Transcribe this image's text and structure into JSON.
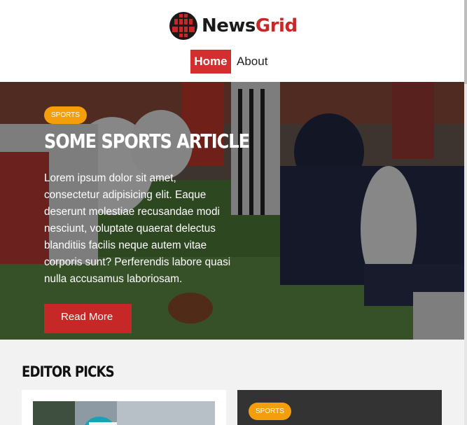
{
  "site": {
    "name_part1": "News",
    "name_part2": "Grid"
  },
  "nav": {
    "items": [
      {
        "label": "Home",
        "active": true
      },
      {
        "label": "About",
        "active": false
      }
    ]
  },
  "hero": {
    "category": "SPORTS",
    "title": "Some Sports Article",
    "body": "Lorem ipsum dolor sit amet, consectetur adipisicing elit. Eaque deserunt molestiae recusandae modi nesciunt, voluptate quaerat delectus blanditiis facilis neque autem vitae corporis sunt? Perferendis labore quasi nulla accusamus laboriosam.",
    "button": "Read More"
  },
  "editor_picks": {
    "title": "Editor Picks",
    "cards": [
      {
        "category": ""
      },
      {
        "category": "SPORTS"
      }
    ]
  },
  "colors": {
    "accent": "#d32f2f",
    "badge": "#f59e0b",
    "dark_card": "#333333"
  }
}
